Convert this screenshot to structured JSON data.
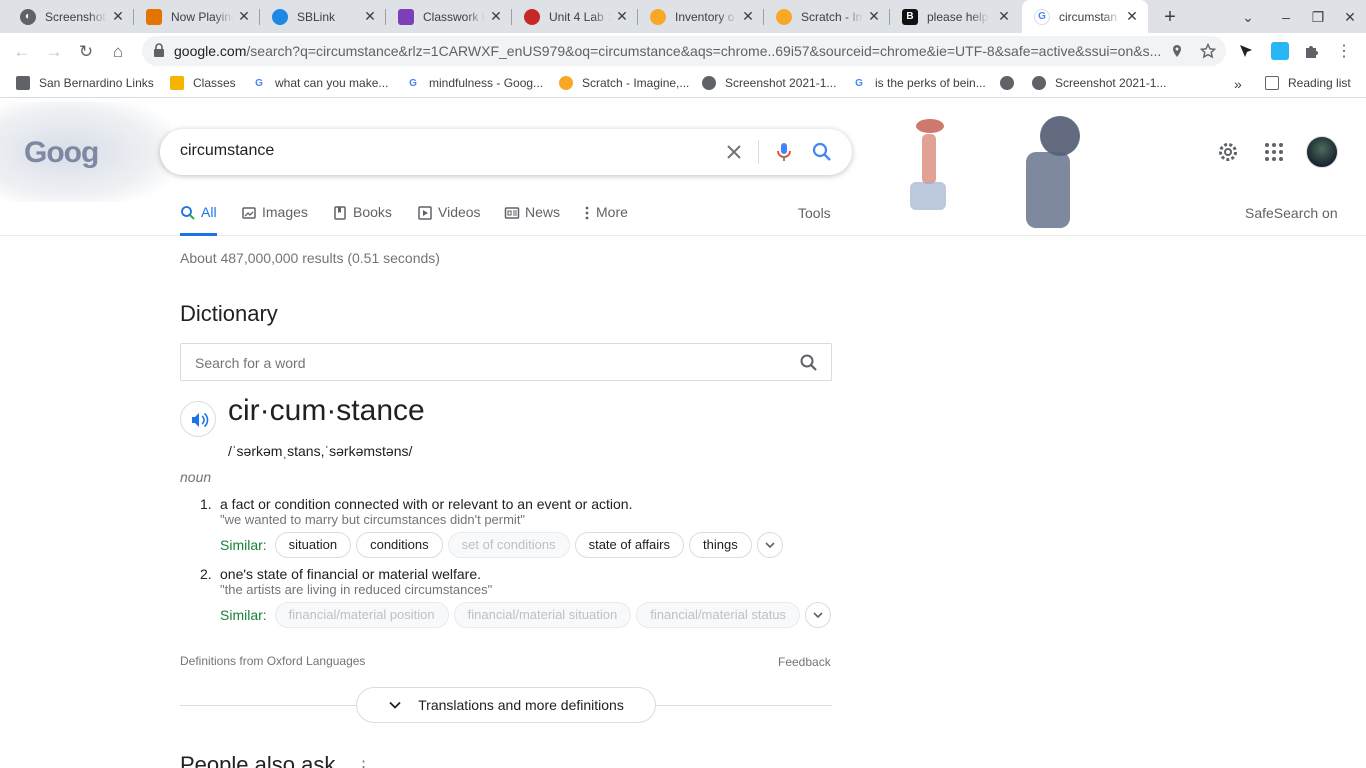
{
  "tabs": [
    {
      "title": "Screenshot",
      "favicon": "globe-icon"
    },
    {
      "title": "Now Playing",
      "favicon": "radio-icon"
    },
    {
      "title": "SBLink",
      "favicon": "cloud-icon"
    },
    {
      "title": "Classwork f",
      "favicon": "classroom-icon"
    },
    {
      "title": "Unit 4 Lab 1",
      "favicon": "circle-logo-icon"
    },
    {
      "title": "Inventory o",
      "favicon": "scratch-icon"
    },
    {
      "title": "Scratch - Im",
      "favicon": "scratch-icon"
    },
    {
      "title": "please help",
      "favicon": "brainly-icon"
    },
    {
      "title": "circumstan",
      "favicon": "google-icon"
    }
  ],
  "address_bar": {
    "host": "google.com",
    "path": "/search?q=circumstance&rlz=1CARWXF_enUS979&oq=circumstance&aqs=chrome..69i57&sourceid=chrome&ie=UTF-8&safe=active&ssui=on&s..."
  },
  "bookmarks": [
    {
      "label": "San Bernardino Links",
      "icon": "folder-icon"
    },
    {
      "label": "Classes",
      "icon": "classroom-icon"
    },
    {
      "label": "what can you make...",
      "icon": "google-icon"
    },
    {
      "label": "mindfulness - Goog...",
      "icon": "google-icon"
    },
    {
      "label": "Scratch - Imagine,...",
      "icon": "scratch-icon"
    },
    {
      "label": "Screenshot 2021-1...",
      "icon": "globe-icon"
    },
    {
      "label": "is the perks of bein...",
      "icon": "google-icon"
    },
    {
      "label": "",
      "icon": "globe-icon"
    },
    {
      "label": "Screenshot 2021-1...",
      "icon": "globe-icon"
    }
  ],
  "reading_list": "Reading list",
  "search": {
    "logo_text": "Goog",
    "query": "circumstance"
  },
  "nav_tabs": [
    {
      "label": "All",
      "icon": "search-icon",
      "active": true
    },
    {
      "label": "Images",
      "icon": "image-icon",
      "active": false
    },
    {
      "label": "Books",
      "icon": "book-icon",
      "active": false
    },
    {
      "label": "Videos",
      "icon": "video-icon",
      "active": false
    },
    {
      "label": "News",
      "icon": "news-icon",
      "active": false
    },
    {
      "label": "More",
      "icon": "more-icon",
      "active": false
    }
  ],
  "tools_label": "Tools",
  "safesearch_label": "SafeSearch on",
  "result_stats": "About 487,000,000 results (0.51 seconds)",
  "dictionary": {
    "heading": "Dictionary",
    "search_placeholder": "Search for a word",
    "headword": "cir·cum·stance",
    "phonetic": "/ˈsərkəmˌstans,ˈsərkəmstəns/",
    "part_of_speech": "noun",
    "definitions": [
      {
        "number": "1.",
        "text": "a fact or condition connected with or relevant to an event or action.",
        "example": "\"we wanted to marry but circumstances didn't permit\"",
        "similar_label": "Similar:",
        "similar": [
          {
            "label": "situation",
            "dim": false
          },
          {
            "label": "conditions",
            "dim": false
          },
          {
            "label": "set of conditions",
            "dim": true
          },
          {
            "label": "state of affairs",
            "dim": false
          },
          {
            "label": "things",
            "dim": false
          }
        ]
      },
      {
        "number": "2.",
        "text": "one's state of financial or material welfare.",
        "example": "\"the artists are living in reduced circumstances\"",
        "similar_label": "Similar:",
        "similar": [
          {
            "label": "financial/material position",
            "dim": true
          },
          {
            "label": "financial/material situation",
            "dim": true
          },
          {
            "label": "financial/material status",
            "dim": true
          }
        ]
      }
    ],
    "source": "Definitions from Oxford Languages",
    "feedback": "Feedback",
    "more_button": "Translations and more definitions"
  },
  "people_also_ask": "People also ask",
  "colors": {
    "accent_blue": "#1a73e8",
    "similar_green": "#188038",
    "tab_strip": "#dee1e6"
  }
}
